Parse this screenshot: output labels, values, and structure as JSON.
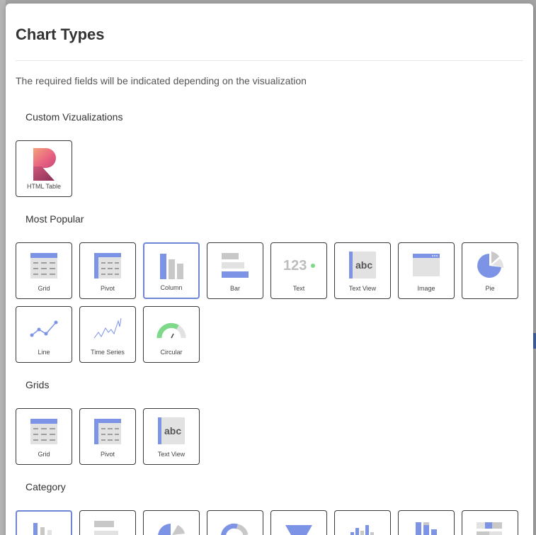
{
  "dialog": {
    "title": "Chart Types",
    "subtitle": "The required fields will be indicated depending on the visualization"
  },
  "sections": {
    "custom": {
      "title": "Custom Vizualizations",
      "items": [
        {
          "label": "HTML Table",
          "icon": "html-table-logo-icon"
        }
      ]
    },
    "popular": {
      "title": "Most Popular",
      "items": [
        {
          "label": "Grid",
          "icon": "grid-icon"
        },
        {
          "label": "Pivot",
          "icon": "pivot-icon"
        },
        {
          "label": "Column",
          "icon": "column-chart-icon",
          "selected": true
        },
        {
          "label": "Bar",
          "icon": "bar-chart-icon"
        },
        {
          "label": "Text",
          "icon": "text-number-icon",
          "glyph": "123"
        },
        {
          "label": "Text View",
          "icon": "text-view-icon",
          "glyph": "abc"
        },
        {
          "label": "Image",
          "icon": "image-icon"
        },
        {
          "label": "Pie",
          "icon": "pie-chart-icon"
        },
        {
          "label": "Line",
          "icon": "line-chart-icon"
        },
        {
          "label": "Time Series",
          "icon": "time-series-icon"
        },
        {
          "label": "Circular",
          "icon": "circular-gauge-icon"
        }
      ]
    },
    "grids": {
      "title": "Grids",
      "items": [
        {
          "label": "Grid",
          "icon": "grid-icon"
        },
        {
          "label": "Pivot",
          "icon": "pivot-icon"
        },
        {
          "label": "Text View",
          "icon": "text-view-icon",
          "glyph": "abc"
        }
      ]
    },
    "category": {
      "title": "Category",
      "items": [
        {
          "icon": "column-chart-icon"
        },
        {
          "icon": "bar-chart-icon"
        },
        {
          "icon": "pie-chart-icon"
        },
        {
          "icon": "doughnut-chart-icon"
        },
        {
          "icon": "funnel-chart-icon"
        },
        {
          "icon": "clustered-column-icon"
        },
        {
          "icon": "stacked-column-icon"
        },
        {
          "icon": "stacked-bar-icon"
        }
      ]
    }
  },
  "colors": {
    "accent": "#7c93e6",
    "grey": "#c8c8c8",
    "green": "#7fd98a",
    "selected_border": "#6f86d6"
  }
}
